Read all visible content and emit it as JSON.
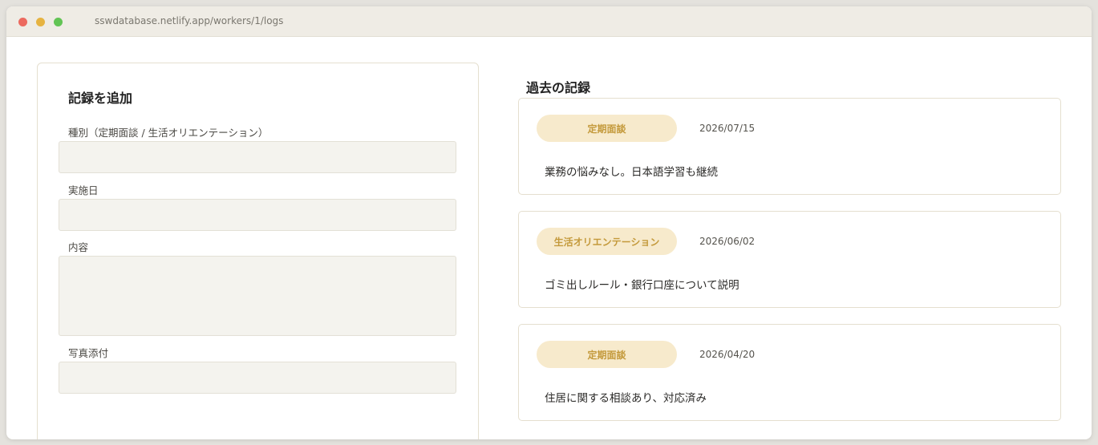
{
  "browser": {
    "url": "sswdatabase.netlify.app/workers/1/logs"
  },
  "form": {
    "title": "記録を追加",
    "fields": [
      {
        "label": "種別（定期面談 / 生活オリエンテーション）",
        "value": "",
        "placeholder": ""
      },
      {
        "label": "実施日",
        "value": "",
        "placeholder": ""
      },
      {
        "label": "内容",
        "value": "",
        "placeholder": ""
      },
      {
        "label": "写真添付",
        "value": "",
        "placeholder": ""
      }
    ]
  },
  "history": {
    "title": "過去の記録",
    "entries": [
      {
        "type": "定期面談",
        "date": "2026/07/15",
        "content": "業務の悩みなし。日本語学習も継続"
      },
      {
        "type": "生活オリエンテーション",
        "date": "2026/06/02",
        "content": "ゴミ出しルール・銀行口座について説明"
      },
      {
        "type": "定期面談",
        "date": "2026/04/20",
        "content": "住居に関する相談あり、対応済み"
      }
    ]
  },
  "colors": {
    "badge_bg": "#f7eacc",
    "badge_text": "#c49a3c",
    "card_border": "#e5dfcf",
    "input_bg": "#f4f3ee"
  }
}
